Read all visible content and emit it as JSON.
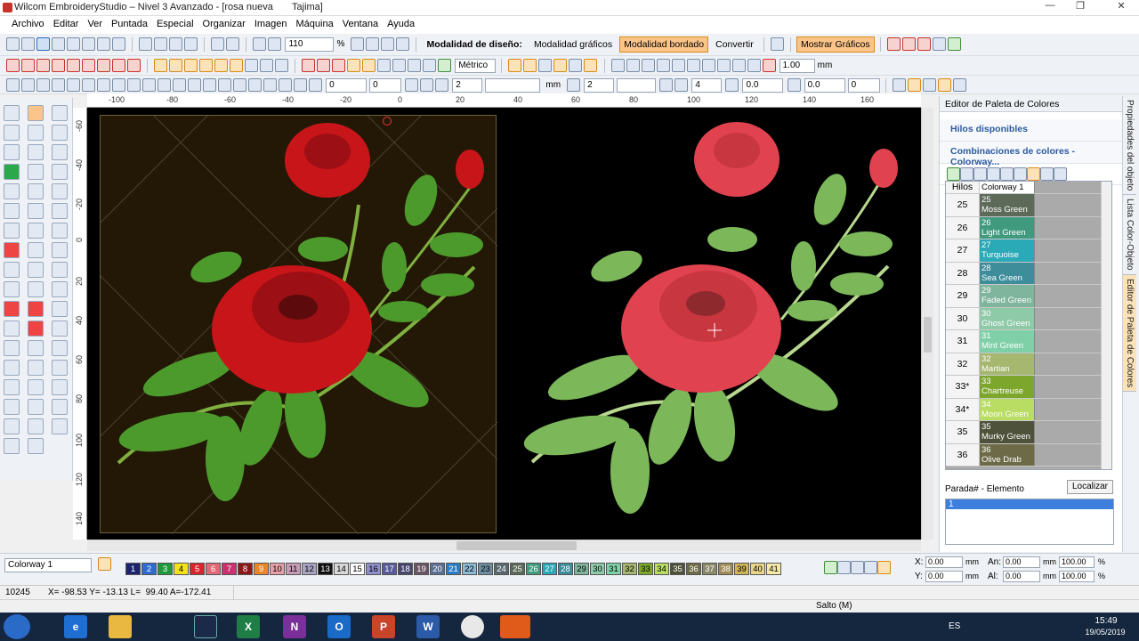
{
  "window": {
    "title": "Wilcom EmbroideryStudio – Nivel 3 Avanzado - [rosa nueva       Tajima]"
  },
  "menu": [
    "Archivo",
    "Editar",
    "Ver",
    "Puntada",
    "Especial",
    "Organizar",
    "Imagen",
    "Máquina",
    "Ventana",
    "Ayuda"
  ],
  "toolbar1": {
    "zoom_value": "110",
    "zoom_unit": "%",
    "design_mode_label": "Modalidad de diseño:",
    "graphics_mode": "Modalidad gráficos",
    "embroidery_mode": "Modalidad bordado",
    "convert": "Convertir",
    "show_graphics": "Mostrar Gráficos"
  },
  "toolbar2": {
    "units": "Métrico",
    "value": "1.00",
    "value_unit": "mm"
  },
  "toolbar3": {
    "angle": "0",
    "field2": "0",
    "field3": "2",
    "unit1": "mm",
    "field4": "2",
    "field5": "4",
    "field6": "0.0",
    "field7": "0.0",
    "field8": "0"
  },
  "ruler_h": [
    "-100",
    "-80",
    "-60",
    "-40",
    "-20",
    "0",
    "20",
    "40",
    "60",
    "80",
    "100",
    "120",
    "140",
    "160"
  ],
  "ruler_v": [
    "-60",
    "-40",
    "-20",
    "0",
    "20",
    "40",
    "60",
    "80",
    "100",
    "120",
    "140"
  ],
  "right_panel": {
    "title": "Editor de Paleta de Colores",
    "section1": "Hilos disponibles",
    "section2": "Combinaciones de colores - Colorway...",
    "col_hilos": "Hilos",
    "col_colorway": "Colorway 1",
    "rows": [
      {
        "num": "25",
        "idx": "25",
        "name": "Moss Green",
        "color": "#5d6a5a"
      },
      {
        "num": "26",
        "idx": "26",
        "name": "Light Green",
        "color": "#3f9a7e"
      },
      {
        "num": "27",
        "idx": "27",
        "name": "Turquoise",
        "color": "#2aa9b7"
      },
      {
        "num": "28",
        "idx": "28",
        "name": "Sea Green",
        "color": "#3d8d9a"
      },
      {
        "num": "29",
        "idx": "29",
        "name": "Faded Green",
        "color": "#7fb59c"
      },
      {
        "num": "30",
        "idx": "30",
        "name": "Ghost Green",
        "color": "#8ec9a8"
      },
      {
        "num": "31",
        "idx": "31",
        "name": "Mint Green",
        "color": "#7fd0a8"
      },
      {
        "num": "32",
        "idx": "32",
        "name": "Martian Green",
        "color": "#a6b770"
      },
      {
        "num": "33*",
        "idx": "33",
        "name": "Chartreuse",
        "color": "#7da62d"
      },
      {
        "num": "34*",
        "idx": "34",
        "name": "Moon Green",
        "color": "#b9dc62"
      },
      {
        "num": "35",
        "idx": "35",
        "name": "Murky Green",
        "color": "#4f523a"
      },
      {
        "num": "36",
        "idx": "36",
        "name": "Olive Drab",
        "color": "#6d6a47"
      }
    ],
    "stop_label": "Parada# - Elemento",
    "locate_button": "Localizar",
    "list_value": "1"
  },
  "side_tabs": [
    "Propiedades del objeto",
    "Lista Color-Objeto",
    "Editor de Paleta de Colores"
  ],
  "bottom": {
    "colorway": "Colorway 1",
    "swatches": [
      {
        "n": "1",
        "c": "#1c2470",
        "t": "#fff"
      },
      {
        "n": "2",
        "c": "#2d6bcf",
        "t": "#fff"
      },
      {
        "n": "3",
        "c": "#1e9a3a",
        "t": "#fff"
      },
      {
        "n": "4",
        "c": "#f3e21a",
        "t": "#000"
      },
      {
        "n": "5",
        "c": "#d8262c",
        "t": "#fff"
      },
      {
        "n": "6",
        "c": "#e06a78",
        "t": "#fff"
      },
      {
        "n": "7",
        "c": "#c9326e",
        "t": "#fff"
      },
      {
        "n": "8",
        "c": "#8a1a1a",
        "t": "#fff"
      },
      {
        "n": "9",
        "c": "#e8862a",
        "t": "#fff"
      },
      {
        "n": "10",
        "c": "#e7a0a8",
        "t": "#000"
      },
      {
        "n": "11",
        "c": "#c79ab8",
        "t": "#000"
      },
      {
        "n": "12",
        "c": "#a9a3c2",
        "t": "#000"
      },
      {
        "n": "13",
        "c": "#111111",
        "t": "#fff"
      },
      {
        "n": "14",
        "c": "#d8d8d8",
        "t": "#000"
      },
      {
        "n": "15",
        "c": "#ffffff",
        "t": "#000"
      },
      {
        "n": "16",
        "c": "#8e8ecb",
        "t": "#000"
      },
      {
        "n": "17",
        "c": "#5a5a9a",
        "t": "#fff"
      },
      {
        "n": "18",
        "c": "#47476e",
        "t": "#fff"
      },
      {
        "n": "19",
        "c": "#6a5464",
        "t": "#fff"
      },
      {
        "n": "20",
        "c": "#5b6e93",
        "t": "#fff"
      },
      {
        "n": "21",
        "c": "#2a7cc8",
        "t": "#fff"
      },
      {
        "n": "22",
        "c": "#8cb9d4",
        "t": "#000"
      },
      {
        "n": "23",
        "c": "#6e8ea0",
        "t": "#000"
      },
      {
        "n": "24",
        "c": "#59686e",
        "t": "#fff"
      },
      {
        "n": "25",
        "c": "#5d6a5a",
        "t": "#fff"
      },
      {
        "n": "26",
        "c": "#3f9a7e",
        "t": "#fff"
      },
      {
        "n": "27",
        "c": "#2aa9b7",
        "t": "#fff"
      },
      {
        "n": "28",
        "c": "#3d8d9a",
        "t": "#fff"
      },
      {
        "n": "29",
        "c": "#7fb59c",
        "t": "#000"
      },
      {
        "n": "30",
        "c": "#8ec9a8",
        "t": "#000"
      },
      {
        "n": "31",
        "c": "#7fd0a8",
        "t": "#000"
      },
      {
        "n": "32",
        "c": "#a6b770",
        "t": "#000"
      },
      {
        "n": "33",
        "c": "#7da62d",
        "t": "#000"
      },
      {
        "n": "34",
        "c": "#b9dc62",
        "t": "#000"
      },
      {
        "n": "35",
        "c": "#4f523a",
        "t": "#fff"
      },
      {
        "n": "36",
        "c": "#6d6a47",
        "t": "#fff"
      },
      {
        "n": "37",
        "c": "#8b8a6a",
        "t": "#fff"
      },
      {
        "n": "38",
        "c": "#a08c5a",
        "t": "#fff"
      },
      {
        "n": "39",
        "c": "#d1b35a",
        "t": "#000"
      },
      {
        "n": "40",
        "c": "#e8d48a",
        "t": "#000"
      },
      {
        "n": "41",
        "c": "#f5e9a8",
        "t": "#000"
      }
    ],
    "x_label": "X:",
    "x_val": "0.00",
    "y_label": "Y:",
    "y_val": "0.00",
    "an_label": "An:",
    "an_val": "0.00",
    "al_label": "Al:",
    "al_val": "0.00",
    "mm": "mm",
    "pct1": "100.00",
    "pct2": "100.00",
    "pct": "%"
  },
  "status": {
    "count": "10245",
    "coords": "X= -98.53 Y= -13.13 L=  99.40 A=-172.41",
    "mode": "Salto (M)"
  },
  "taskbar": {
    "lang": "ES",
    "time": "15:49",
    "date": "19/05/2019"
  }
}
